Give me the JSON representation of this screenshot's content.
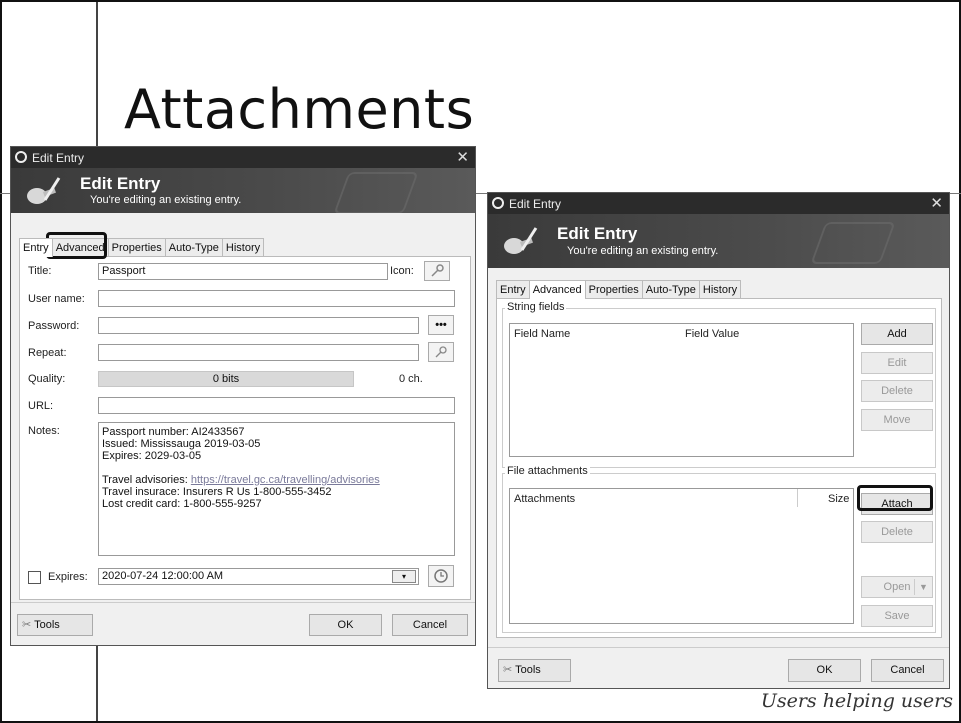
{
  "slide": {
    "title": "Attachments",
    "brand": "Users helping users"
  },
  "left_dialog": {
    "window_title": "Edit Entry",
    "banner_title": "Edit Entry",
    "banner_subtitle": "You're editing an existing entry.",
    "tabs": [
      "Entry",
      "Advanced",
      "Properties",
      "Auto-Type",
      "History"
    ],
    "active_tab": "Entry",
    "highlighted_tab": "Advanced",
    "labels": {
      "title": "Title:",
      "user_name": "User name:",
      "password": "Password:",
      "repeat": "Repeat:",
      "quality": "Quality:",
      "url": "URL:",
      "notes": "Notes:",
      "icon": "Icon:",
      "expires": "Expires:"
    },
    "values": {
      "title": "Passport",
      "user_name": "",
      "password": "",
      "repeat": "",
      "quality_bits": "0 bits",
      "quality_chars": "0 ch.",
      "url": "",
      "expires": "2020-07-24 12:00:00 AM"
    },
    "notes": {
      "line1": "Passport number: AI2433567",
      "line2": "Issued: Mississauga 2019-03-05",
      "line3": "Expires: 2029-03-05",
      "line4_prefix": "Travel advisories: ",
      "line4_link": "https://travel.gc.ca/travelling/advisories",
      "line5": "Travel insurace: Insurers R Us 1-800-555-3452",
      "line6": "Lost credit card: 1-800-555-9257"
    },
    "password_toggle": "•••",
    "buttons": {
      "tools": "Tools",
      "ok": "OK",
      "cancel": "Cancel"
    }
  },
  "right_dialog": {
    "window_title": "Edit Entry",
    "banner_title": "Edit Entry",
    "banner_subtitle": "You're editing an existing entry.",
    "tabs": [
      "Entry",
      "Advanced",
      "Properties",
      "Auto-Type",
      "History"
    ],
    "active_tab": "Advanced",
    "string_fields": {
      "group_label": "String fields",
      "col_name": "Field Name",
      "col_value": "Field Value",
      "buttons": {
        "add": "Add",
        "edit": "Edit",
        "delete": "Delete",
        "move": "Move"
      }
    },
    "file_attachments": {
      "group_label": "File attachments",
      "col_attachments": "Attachments",
      "col_size": "Size",
      "buttons": {
        "attach": "Attach",
        "delete": "Delete",
        "open": "Open",
        "save": "Save"
      }
    },
    "buttons": {
      "tools": "Tools",
      "ok": "OK",
      "cancel": "Cancel"
    }
  },
  "colors": {
    "titlebar": "#2b2b2b",
    "banner": "#454545",
    "highlight_border": "#111111"
  }
}
